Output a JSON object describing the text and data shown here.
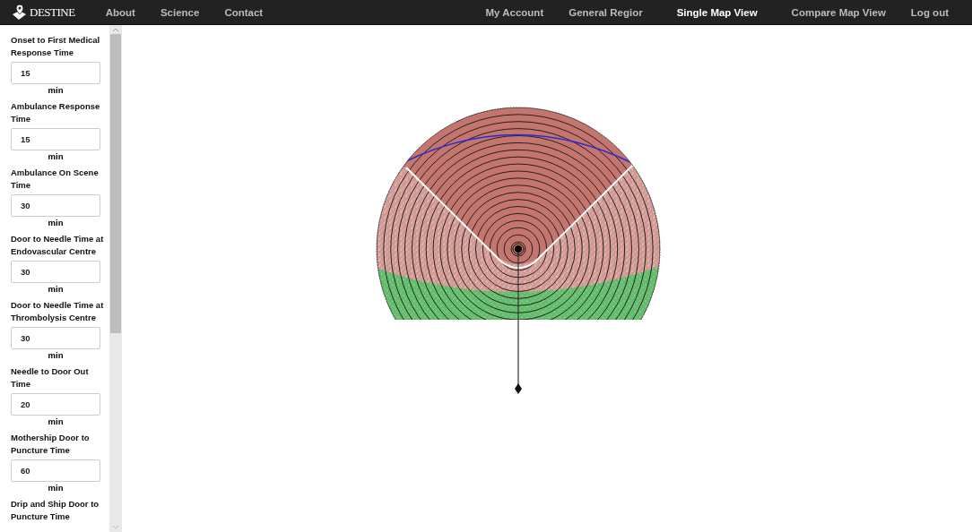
{
  "navbar": {
    "brand": "DESTINE",
    "left_links": [
      {
        "label": "About",
        "selected": false
      },
      {
        "label": "Science",
        "selected": false
      },
      {
        "label": "Contact",
        "selected": false
      }
    ],
    "right_links": [
      {
        "label": "My Account",
        "selected": false
      },
      {
        "label": "General Regior",
        "selected": false
      },
      {
        "label": "Single Map View",
        "selected": true
      },
      {
        "label": "Compare Map View",
        "selected": false
      },
      {
        "label": "Log out",
        "selected": false
      }
    ]
  },
  "sidebar": {
    "fields": [
      {
        "label": "Onset to First Medical Response Time",
        "value": "15",
        "unit": "min"
      },
      {
        "label": "Ambulance Response Time",
        "value": "15",
        "unit": "min"
      },
      {
        "label": "Ambulance On Scene Time",
        "value": "30",
        "unit": "min"
      },
      {
        "label": "Door to Needle Time at Endovascular Centre",
        "value": "30",
        "unit": "min"
      },
      {
        "label": "Door to Needle Time at Thrombolysis Centre",
        "value": "30",
        "unit": "min"
      },
      {
        "label": "Needle to Door Out Time",
        "value": "20",
        "unit": "min"
      },
      {
        "label": "Mothership Door to Puncture Time",
        "value": "60",
        "unit": "min"
      },
      {
        "label": "Drip and Ship Door to Puncture Time"
      }
    ]
  }
}
